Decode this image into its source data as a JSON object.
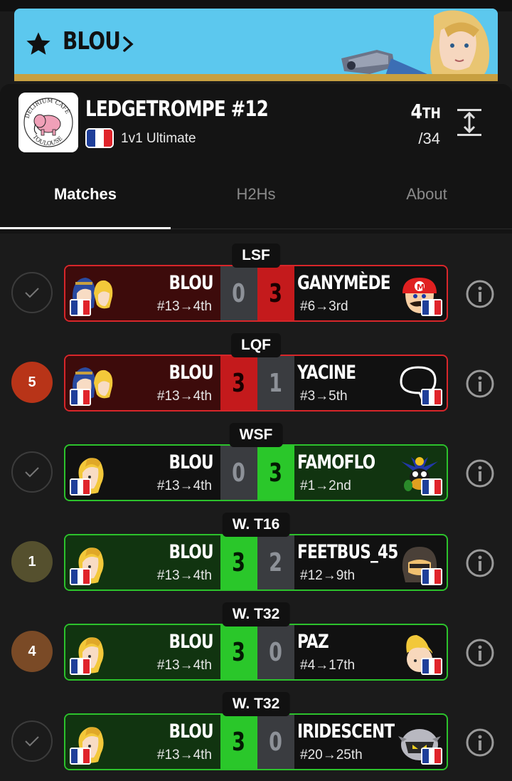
{
  "banner": {
    "player_name": "BLOU"
  },
  "tournament": {
    "name": "LEDGETROMPE #12",
    "game": "1v1 Ultimate",
    "placement": "4",
    "placement_suffix": "TH",
    "entrants": "/34",
    "logo_text_top": "DELIRIUM CAFÉ",
    "logo_text_bottom": "TOULOUSE"
  },
  "tabs": [
    {
      "label": "Matches"
    },
    {
      "label": "H2Hs"
    },
    {
      "label": "About"
    }
  ],
  "colors": {
    "loss": "#d8262a",
    "win": "#2cc22c",
    "banner": "#5cc8ee"
  },
  "matches": [
    {
      "round": "LSF",
      "side": "check",
      "p1": {
        "name": "BLOU",
        "seed": "#13→4th",
        "score": "0"
      },
      "p2": {
        "name": "GANYMÈDE",
        "seed": "#6→3rd",
        "score": "3"
      }
    },
    {
      "round": "LQF",
      "side": "5",
      "p1": {
        "name": "BLOU",
        "seed": "#13→4th",
        "score": "3"
      },
      "p2": {
        "name": "YACINE",
        "seed": "#3→5th",
        "score": "1"
      }
    },
    {
      "round": "WSF",
      "side": "check",
      "p1": {
        "name": "BLOU",
        "seed": "#13→4th",
        "score": "0"
      },
      "p2": {
        "name": "FAMOFLO",
        "seed": "#1→2nd",
        "score": "3"
      }
    },
    {
      "round": "W. T16",
      "side": "1",
      "p1": {
        "name": "BLOU",
        "seed": "#13→4th",
        "score": "3"
      },
      "p2": {
        "name": "FEETBUS_45",
        "seed": "#12→9th",
        "score": "2"
      }
    },
    {
      "round": "W. T32",
      "side": "4",
      "p1": {
        "name": "BLOU",
        "seed": "#13→4th",
        "score": "3"
      },
      "p2": {
        "name": "PAZ",
        "seed": "#4→17th",
        "score": "0"
      }
    },
    {
      "round": "W. T32",
      "side": "check",
      "p1": {
        "name": "BLOU",
        "seed": "#13→4th",
        "score": "3"
      },
      "p2": {
        "name": "IRIDESCENT",
        "seed": "#20→25th",
        "score": "0"
      }
    }
  ]
}
